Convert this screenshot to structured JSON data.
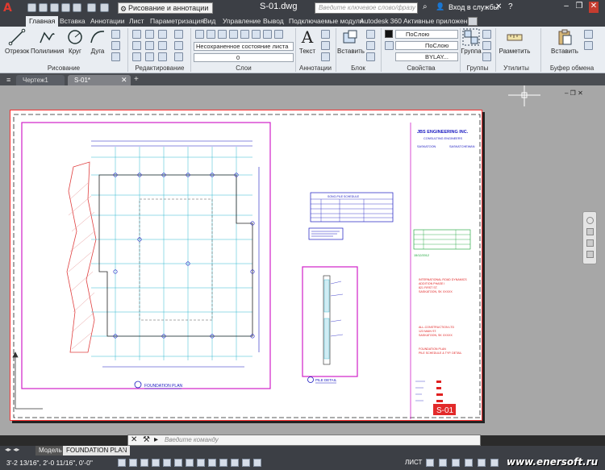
{
  "title_bar": {
    "logo": "A",
    "workspace": "Рисование и аннотации",
    "filename": "S-01.dwg",
    "search_placeholder": "Введите ключевое слово/фразу",
    "signin": "Вход в службы",
    "window_controls": [
      "minimize-icon",
      "restore-icon",
      "close-icon"
    ]
  },
  "ribbon_tabs": [
    "Главная",
    "Вставка",
    "Аннотации",
    "Лист",
    "Параметризация",
    "Вид",
    "Управление",
    "Вывод",
    "Подключаемые модули",
    "Autodesk 360",
    "Активные приложения"
  ],
  "ribbon": {
    "draw": {
      "title": "Рисование",
      "tools": [
        "Отрезок",
        "Полилиния",
        "Круг",
        "Дуга"
      ]
    },
    "modify": {
      "title": "Редактирование"
    },
    "layers": {
      "title": "Слои",
      "state": "Несохраненное состояние листа",
      "current_layer": "0"
    },
    "annotation": {
      "title": "Аннотации",
      "text": "Текст"
    },
    "block": {
      "title": "Блок",
      "insert": "Вставить"
    },
    "properties": {
      "title": "Свойства",
      "color": "ПоСлою",
      "lineweight": "ПоСлою",
      "linetype": "BYLAY..."
    },
    "groups": {
      "title": "Группы",
      "group": "Группа"
    },
    "utilities": {
      "title": "Утилиты",
      "measure": "Разметить"
    },
    "clipboard": {
      "title": "Буфер обмена",
      "paste": "Вставить"
    }
  },
  "file_tabs": [
    "Чертеж1",
    "S-01*"
  ],
  "drawing": {
    "company": "JBS ENGINEERING INC.",
    "subtitle": "CONSULTING ENGINEERS",
    "city_left": "SASKATOON",
    "city_right": "SASKATCHEWAN",
    "schedule_title": "SONO-PILE SCHEDULE",
    "plan_label": "FOUNDATION PLAN",
    "detail_label": "PILE DETAIL",
    "project_lines": [
      "INTERNATIONAL ROAD DYNAMICS",
      "ADDITION PHASE I",
      "821 FIRST ST.",
      "SASKATOON, SK  XXXXX"
    ],
    "contractor_lines": [
      "ALL-CONSTRUCTION LTD",
      "123 MAIN ST.",
      "SASKATOON, SK  XXXXX"
    ],
    "sheet_title_lines": [
      "FOUNDATION PLAN",
      "PILE SCHEDULE & TYP. DETAIL"
    ],
    "date_stamp": "15/12/2012",
    "sheet_number": "S-01"
  },
  "command_line": {
    "placeholder": "Введите команду"
  },
  "layout_tabs": [
    "Модель",
    "FOUNDATION PLAN"
  ],
  "status_bar": {
    "coords": "3'-2 13/16\", 2'-0 11/16\", 0'-0\"",
    "space": "ЛИСТ"
  },
  "watermark": "www.enersoft.ru",
  "colors": {
    "accent": "#e03a2f",
    "magenta": "#d020c8",
    "blue": "#1010c0",
    "cyan": "#00b0c8",
    "red": "#e02020",
    "green": "#10a030"
  }
}
